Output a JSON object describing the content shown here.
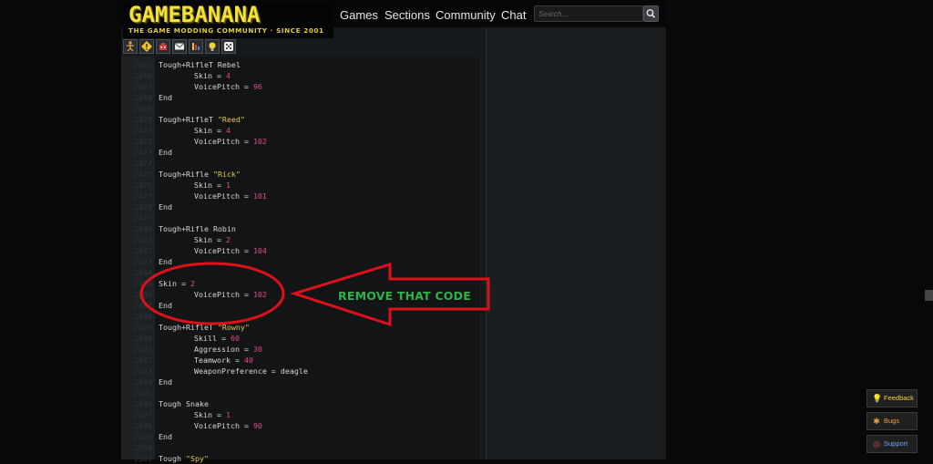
{
  "header": {
    "logo_title": "GAMEBANANA",
    "logo_subtitle": "THE GAME MODDING COMMUNITY · SINCE 2001",
    "nav": [
      {
        "label": "Games"
      },
      {
        "label": "Sections"
      },
      {
        "label": "Community"
      },
      {
        "label": "Chat"
      }
    ],
    "search_placeholder": "Search..."
  },
  "toolbar": [
    {
      "icon": "figure-icon"
    },
    {
      "icon": "warning-icon"
    },
    {
      "icon": "robot-icon"
    },
    {
      "icon": "mail-icon"
    },
    {
      "icon": "bars-icon"
    },
    {
      "icon": "bulb-icon"
    },
    {
      "icon": "dice-icon"
    }
  ],
  "code": {
    "line_numbers": [
      "2465",
      "2466",
      "2467",
      "2468",
      "2469",
      "2470",
      "2471",
      "2472",
      "2473",
      "2474",
      "2475",
      "2476",
      "2477",
      "2478",
      "2479",
      "2480",
      "2481",
      "2482",
      "2483",
      "2484",
      "2485",
      "2486",
      "2487",
      "2488",
      "2489",
      "2490",
      "2491",
      "2492",
      "2493",
      "2494",
      "2495",
      "2496",
      "2497",
      "2498",
      "2499",
      "2500",
      "2501"
    ],
    "lines": [
      {
        "indent": false,
        "parts": [
          {
            "t": "Tough+RifleT Rebel"
          }
        ]
      },
      {
        "indent": true,
        "parts": [
          {
            "t": "Skin = "
          },
          {
            "t": "4",
            "c": "num"
          }
        ]
      },
      {
        "indent": true,
        "parts": [
          {
            "t": "VoicePitch = "
          },
          {
            "t": "96",
            "c": "num"
          }
        ]
      },
      {
        "indent": false,
        "parts": [
          {
            "t": "End"
          }
        ]
      },
      {
        "indent": false,
        "parts": []
      },
      {
        "indent": false,
        "parts": [
          {
            "t": "Tough+RifleT "
          },
          {
            "t": "\"Reed\"",
            "c": "str"
          }
        ]
      },
      {
        "indent": true,
        "parts": [
          {
            "t": "Skin = "
          },
          {
            "t": "4",
            "c": "num"
          }
        ]
      },
      {
        "indent": true,
        "parts": [
          {
            "t": "VoicePitch = "
          },
          {
            "t": "102",
            "c": "num"
          }
        ]
      },
      {
        "indent": false,
        "parts": [
          {
            "t": "End"
          }
        ]
      },
      {
        "indent": false,
        "parts": []
      },
      {
        "indent": false,
        "parts": [
          {
            "t": "Tough+Rifle "
          },
          {
            "t": "\"Rick\"",
            "c": "str"
          }
        ]
      },
      {
        "indent": true,
        "parts": [
          {
            "t": "Skin = "
          },
          {
            "t": "1",
            "c": "num"
          }
        ]
      },
      {
        "indent": true,
        "parts": [
          {
            "t": "VoicePitch = "
          },
          {
            "t": "101",
            "c": "num"
          }
        ]
      },
      {
        "indent": false,
        "parts": [
          {
            "t": "End"
          }
        ]
      },
      {
        "indent": false,
        "parts": []
      },
      {
        "indent": false,
        "parts": [
          {
            "t": "Tough+Rifle Robin"
          }
        ]
      },
      {
        "indent": true,
        "parts": [
          {
            "t": "Skin = "
          },
          {
            "t": "2",
            "c": "num"
          }
        ]
      },
      {
        "indent": true,
        "parts": [
          {
            "t": "VoicePitch = "
          },
          {
            "t": "104",
            "c": "num"
          }
        ]
      },
      {
        "indent": false,
        "parts": [
          {
            "t": "End"
          }
        ]
      },
      {
        "indent": false,
        "parts": []
      },
      {
        "indent": false,
        "parts": [
          {
            "t": "Skin = "
          },
          {
            "t": "2",
            "c": "num"
          }
        ]
      },
      {
        "indent": true,
        "parts": [
          {
            "t": "VoicePitch = "
          },
          {
            "t": "102",
            "c": "num"
          }
        ]
      },
      {
        "indent": false,
        "parts": [
          {
            "t": "End"
          }
        ]
      },
      {
        "indent": false,
        "parts": []
      },
      {
        "indent": false,
        "parts": [
          {
            "t": "Tough+RifleT "
          },
          {
            "t": "\"Rowny\"",
            "c": "str"
          }
        ]
      },
      {
        "indent": true,
        "parts": [
          {
            "t": "Skill = "
          },
          {
            "t": "60",
            "c": "num"
          }
        ]
      },
      {
        "indent": true,
        "parts": [
          {
            "t": "Aggression = "
          },
          {
            "t": "30",
            "c": "num"
          }
        ]
      },
      {
        "indent": true,
        "parts": [
          {
            "t": "Teamwork = "
          },
          {
            "t": "40",
            "c": "num"
          }
        ]
      },
      {
        "indent": true,
        "parts": [
          {
            "t": "WeaponPreference = deagle"
          }
        ]
      },
      {
        "indent": false,
        "parts": [
          {
            "t": "End"
          }
        ]
      },
      {
        "indent": false,
        "parts": []
      },
      {
        "indent": false,
        "parts": [
          {
            "t": "Tough Snake"
          }
        ]
      },
      {
        "indent": true,
        "parts": [
          {
            "t": "Skin = "
          },
          {
            "t": "1",
            "c": "num"
          }
        ]
      },
      {
        "indent": true,
        "parts": [
          {
            "t": "VoicePitch = "
          },
          {
            "t": "90",
            "c": "num"
          }
        ]
      },
      {
        "indent": false,
        "parts": [
          {
            "t": "End"
          }
        ]
      },
      {
        "indent": false,
        "parts": []
      },
      {
        "indent": false,
        "parts": [
          {
            "t": "Tough "
          },
          {
            "t": "\"Spy\"",
            "c": "str"
          }
        ]
      }
    ]
  },
  "annotation": {
    "label": "REMOVE THAT CODE",
    "color": "#e0101a",
    "label_color": "#2fb24a"
  },
  "side_buttons": [
    {
      "label": "Feedback",
      "icon": "bulb-icon",
      "color": "#f3d23a"
    },
    {
      "label": "Bugs",
      "icon": "bug-icon",
      "color": "#e8a23a"
    },
    {
      "label": "Support",
      "icon": "lifebuoy-icon",
      "color": "#6fa8ff"
    }
  ],
  "colors": {
    "background": "#080808",
    "code_bg": "#121416",
    "number": "#e04a8a",
    "string": "#e6c84a"
  }
}
